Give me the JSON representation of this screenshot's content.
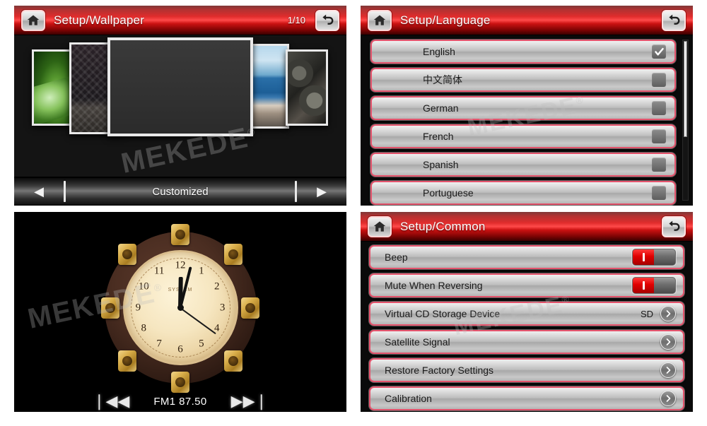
{
  "theme": {
    "header_red": "#e02020",
    "list_border_pink": "#e4536c",
    "toggle_on_red": "#e00000",
    "panel_bg": "#0a0a0a"
  },
  "watermark": {
    "text": "MEKEDE",
    "registered": "®"
  },
  "wallpaper_panel": {
    "home_icon": "home-icon",
    "title": "Setup/Wallpaper",
    "page_indicator": "1/10",
    "back_icon": "back-arrow-icon",
    "thumbnails": [
      {
        "name": "leaf-wallpaper",
        "description": "green leaf"
      },
      {
        "name": "quilt-wallpaper",
        "description": "dark quilted texture"
      },
      {
        "name": "selected-wallpaper",
        "description": "dark gray selected wallpaper"
      },
      {
        "name": "beach-wallpaper",
        "description": "beach and sea"
      },
      {
        "name": "gears-wallpaper",
        "description": "metal gears"
      }
    ],
    "prev_icon": "◀",
    "next_icon": "▶",
    "mode_label": "Customized"
  },
  "language_panel": {
    "home_icon": "home-icon",
    "title": "Setup/Language",
    "back_icon": "back-arrow-icon",
    "items": [
      {
        "label": "English",
        "checked": true
      },
      {
        "label": "中文简体",
        "checked": false
      },
      {
        "label": "German",
        "checked": false
      },
      {
        "label": "French",
        "checked": false
      },
      {
        "label": "Spanish",
        "checked": false
      },
      {
        "label": "Portuguese",
        "checked": false
      }
    ],
    "scroll_position_percent": 0
  },
  "clock_panel": {
    "clock": {
      "numerals": [
        "12",
        "1",
        "2",
        "3",
        "4",
        "5",
        "6",
        "7",
        "8",
        "9",
        "10",
        "11"
      ],
      "brand": "SYSTEM",
      "hour": 12,
      "minute": 2,
      "second": 21
    },
    "radio": {
      "prev_icon": "❘◀◀",
      "band_frequency": "FM1 87.50",
      "next_icon": "▶▶❘"
    }
  },
  "common_panel": {
    "home_icon": "home-icon",
    "title": "Setup/Common",
    "back_icon": "back-arrow-icon",
    "rows": [
      {
        "label": "Beep",
        "control": "toggle",
        "state": "on",
        "value": ""
      },
      {
        "label": "Mute When Reversing",
        "control": "toggle",
        "state": "on",
        "value": ""
      },
      {
        "label": "Virtual CD Storage Device",
        "control": "chevron",
        "state": "",
        "value": "SD"
      },
      {
        "label": "Satellite Signal",
        "control": "chevron",
        "state": "",
        "value": ""
      },
      {
        "label": "Restore Factory Settings",
        "control": "chevron",
        "state": "",
        "value": ""
      },
      {
        "label": "Calibration",
        "control": "chevron",
        "state": "",
        "value": ""
      }
    ]
  }
}
